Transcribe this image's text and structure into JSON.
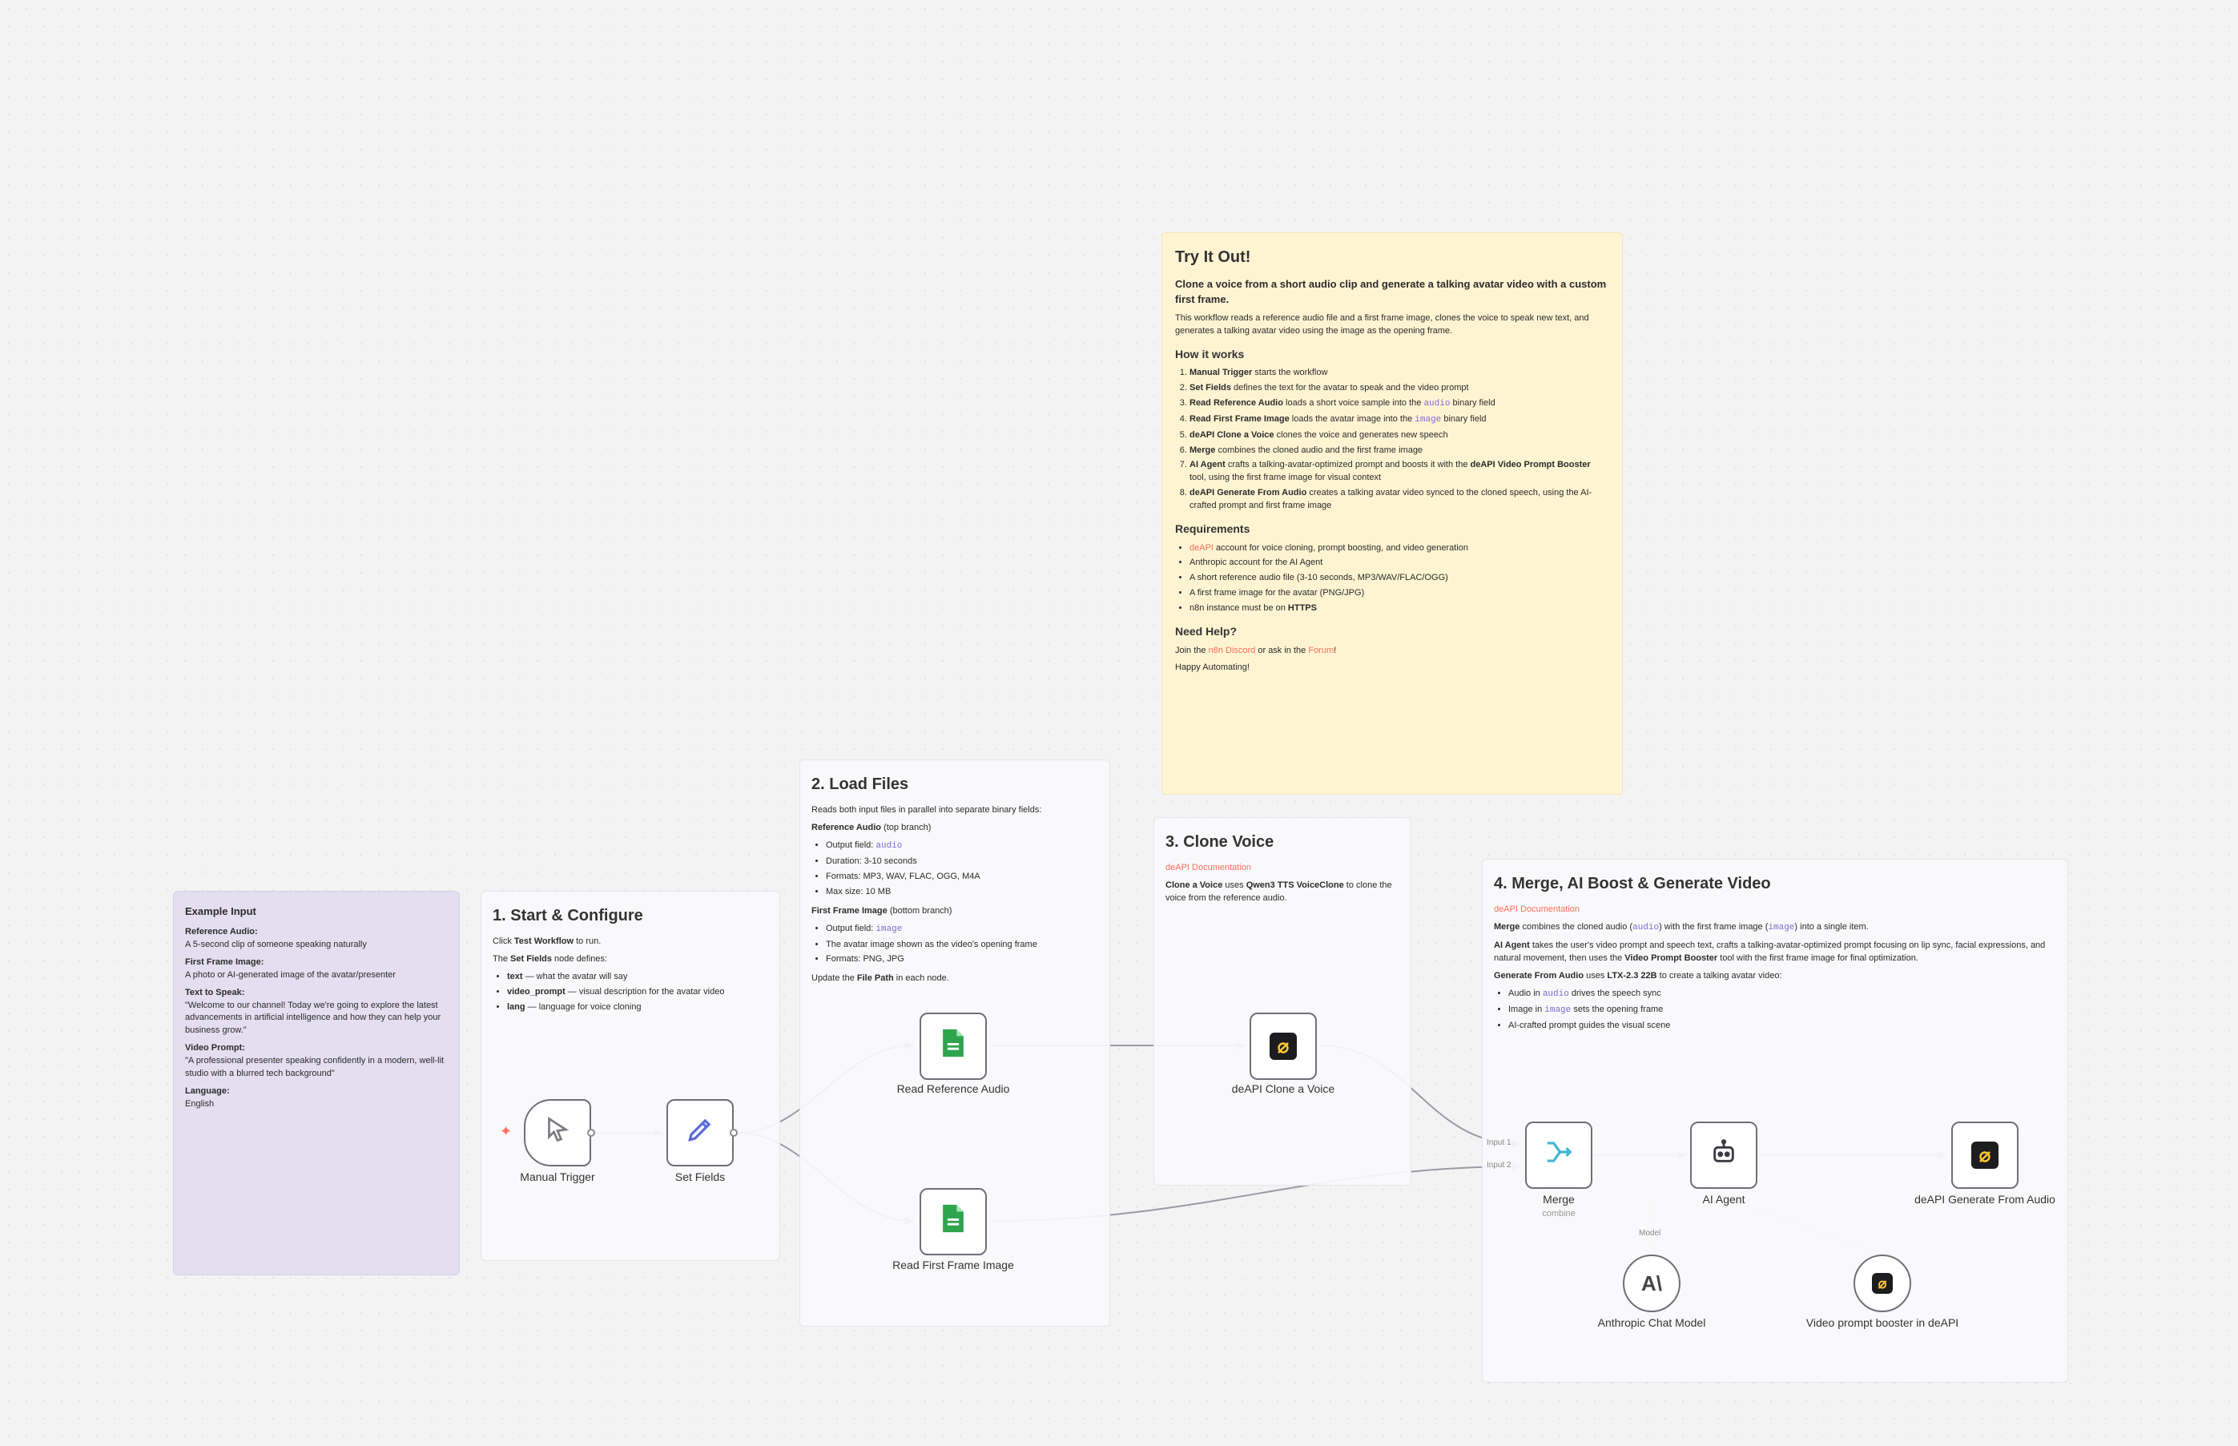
{
  "colors": {
    "link": "#ff6d5a",
    "code": "#7d6bd0",
    "sticky_yellow": "#fff4d2",
    "sticky_purple": "#e3def0"
  },
  "example": {
    "title": "Example Input",
    "items": [
      {
        "label": "Reference Audio:",
        "value": "A 5-second clip of someone speaking naturally"
      },
      {
        "label": "First Frame Image:",
        "value": "A photo or AI-generated image of the avatar/presenter"
      },
      {
        "label": "Text to Speak:",
        "value": "\"Welcome to our channel! Today we're going to explore the latest advancements in artificial intelligence and how they can help your business grow.\""
      },
      {
        "label": "Video Prompt:",
        "value": "\"A professional presenter speaking confidently in a modern, well-lit studio with a blurred tech background\""
      },
      {
        "label": "Language:",
        "value": "English"
      }
    ]
  },
  "start": {
    "title": "1. Start & Configure",
    "p1_pre": "Click ",
    "p1_bold": "Test Workflow",
    "p1_post": " to run.",
    "p2_pre": "The ",
    "p2_bold": "Set Fields",
    "p2_post": " node defines:",
    "items": [
      {
        "bold": "text",
        "rest": " — what the avatar will say"
      },
      {
        "bold": "video_prompt",
        "rest": " — visual description for the avatar video"
      },
      {
        "bold": "lang",
        "rest": " — language for voice cloning"
      }
    ]
  },
  "load": {
    "title": "2. Load Files",
    "intro": "Reads both input files in parallel into separate binary fields:",
    "ref_bold": "Reference Audio",
    "ref_rest": " (top branch)",
    "ref_items": {
      "i1": "Output field: ",
      "i1_code": "audio",
      "i2": "Duration: 3-10 seconds",
      "i3": "Formats: MP3, WAV, FLAC, OGG, M4A",
      "i4": "Max size: 10 MB"
    },
    "ff_bold": "First Frame Image",
    "ff_rest": " (bottom branch)",
    "ff_items": {
      "i1": "Output field: ",
      "i1_code": "image",
      "i2": "The avatar image shown as the video's opening frame",
      "i3": "Formats: PNG, JPG"
    },
    "update_pre": "Update the ",
    "update_bold": "File Path",
    "update_post": " in each node."
  },
  "clone": {
    "title": "3. Clone Voice",
    "doc_link": "deAPI Documentation",
    "p_bold": "Clone a Voice",
    "p_mid": " uses ",
    "p_bold2": "Qwen3 TTS VoiceClone",
    "p_post": " to clone the voice from the reference audio."
  },
  "merge": {
    "title": "4. Merge, AI Boost & Generate Video",
    "doc_link": "deAPI Documentation",
    "p1_bold": "Merge",
    "p1_a": " combines the cloned audio (",
    "p1_code1": "audio",
    "p1_b": ") with the first frame image (",
    "p1_code2": "image",
    "p1_c": ") into a single item.",
    "p2_bold": "AI Agent",
    "p2_a": " takes the user's video prompt and speech text, crafts a talking-avatar-optimized prompt focusing on lip sync, facial expressions, and natural movement, then uses the ",
    "p2_bold2": "Video Prompt Booster",
    "p2_b": " tool with the first frame image for final optimization.",
    "p3_bold": "Generate From Audio",
    "p3_a": " uses ",
    "p3_bold2": "LTX-2.3 22B",
    "p3_b": " to create a talking avatar video:",
    "items": [
      {
        "pre": "Audio in ",
        "code": "audio",
        "post": " drives the speech sync"
      },
      {
        "pre": "Image in ",
        "code": "image",
        "post": " sets the opening frame"
      },
      {
        "pre": "AI-crafted prompt guides the visual scene",
        "code": "",
        "post": ""
      }
    ]
  },
  "tryit": {
    "title": "Try It Out!",
    "lead": "Clone a voice from a short audio clip and generate a talking avatar video with a custom first frame.",
    "intro": "This workflow reads a reference audio file and a first frame image, clones the voice to speak new text, and generates a talking avatar video using the image as the opening frame.",
    "how_title": "How it works",
    "steps": [
      {
        "bold": "Manual Trigger",
        "a": " starts the workflow",
        "code": "",
        "b": ""
      },
      {
        "bold": "Set Fields",
        "a": " defines the text for the avatar to speak and the video prompt",
        "code": "",
        "b": ""
      },
      {
        "bold": "Read Reference Audio",
        "a": " loads a short voice sample into the ",
        "code": "audio",
        "b": " binary field"
      },
      {
        "bold": "Read First Frame Image",
        "a": " loads the avatar image into the ",
        "code": "image",
        "b": " binary field"
      },
      {
        "bold": "deAPI Clone a Voice",
        "a": " clones the voice and generates new speech",
        "code": "",
        "b": ""
      },
      {
        "bold": "Merge",
        "a": " combines the cloned audio and the first frame image",
        "code": "",
        "b": ""
      },
      {
        "bold": "AI Agent",
        "a": " crafts a talking-avatar-optimized prompt and boosts it with the ",
        "code": "",
        "b": "",
        "bold2": "deAPI Video Prompt Booster",
        "c": " tool, using the first frame image for visual context"
      },
      {
        "bold": "deAPI Generate From Audio",
        "a": " creates a talking avatar video synced to the cloned speech, using the AI-crafted prompt and first frame image",
        "code": "",
        "b": ""
      }
    ],
    "req_title": "Requirements",
    "reqs": [
      {
        "link": "deAPI",
        "text": " account for voice cloning, prompt boosting, and video generation",
        "bold": ""
      },
      {
        "link": "",
        "text": "Anthropic account for the AI Agent",
        "bold": ""
      },
      {
        "link": "",
        "text": "A short reference audio file (3-10 seconds, MP3/WAV/FLAC/OGG)",
        "bold": ""
      },
      {
        "link": "",
        "text": "A first frame image for the avatar (PNG/JPG)",
        "bold": ""
      },
      {
        "link": "",
        "text": "n8n instance must be on ",
        "bold": "HTTPS"
      }
    ],
    "help_title": "Need Help?",
    "help_a": "Join the ",
    "help_link1": "n8n Discord",
    "help_b": " or ask in the ",
    "help_link2": "Forum",
    "help_c": "!",
    "closing": "Happy Automating!"
  },
  "nodes": {
    "manual_trigger": "Manual Trigger",
    "set_fields": "Set Fields",
    "read_ref_audio": "Read Reference Audio",
    "read_first_frame": "Read First Frame Image",
    "clone_voice": "deAPI Clone a Voice",
    "merge": "Merge",
    "merge_sub": "combine",
    "merge_input1": "Input 1",
    "merge_input2": "Input 2",
    "ai_agent": "AI Agent",
    "agent_model_port": "Model",
    "generate": "deAPI Generate From Audio",
    "anthropic": "Anthropic Chat Model",
    "booster": "Video prompt booster in deAPI"
  },
  "icons": {
    "trigger": "cursor-icon",
    "set": "pencil-icon",
    "file": "file-icon",
    "deapi": "deapi-logo-icon",
    "merge": "merge-icon",
    "agent": "robot-icon",
    "anthropic": "anthropic-logo-icon",
    "bolt": "lightning-icon"
  }
}
